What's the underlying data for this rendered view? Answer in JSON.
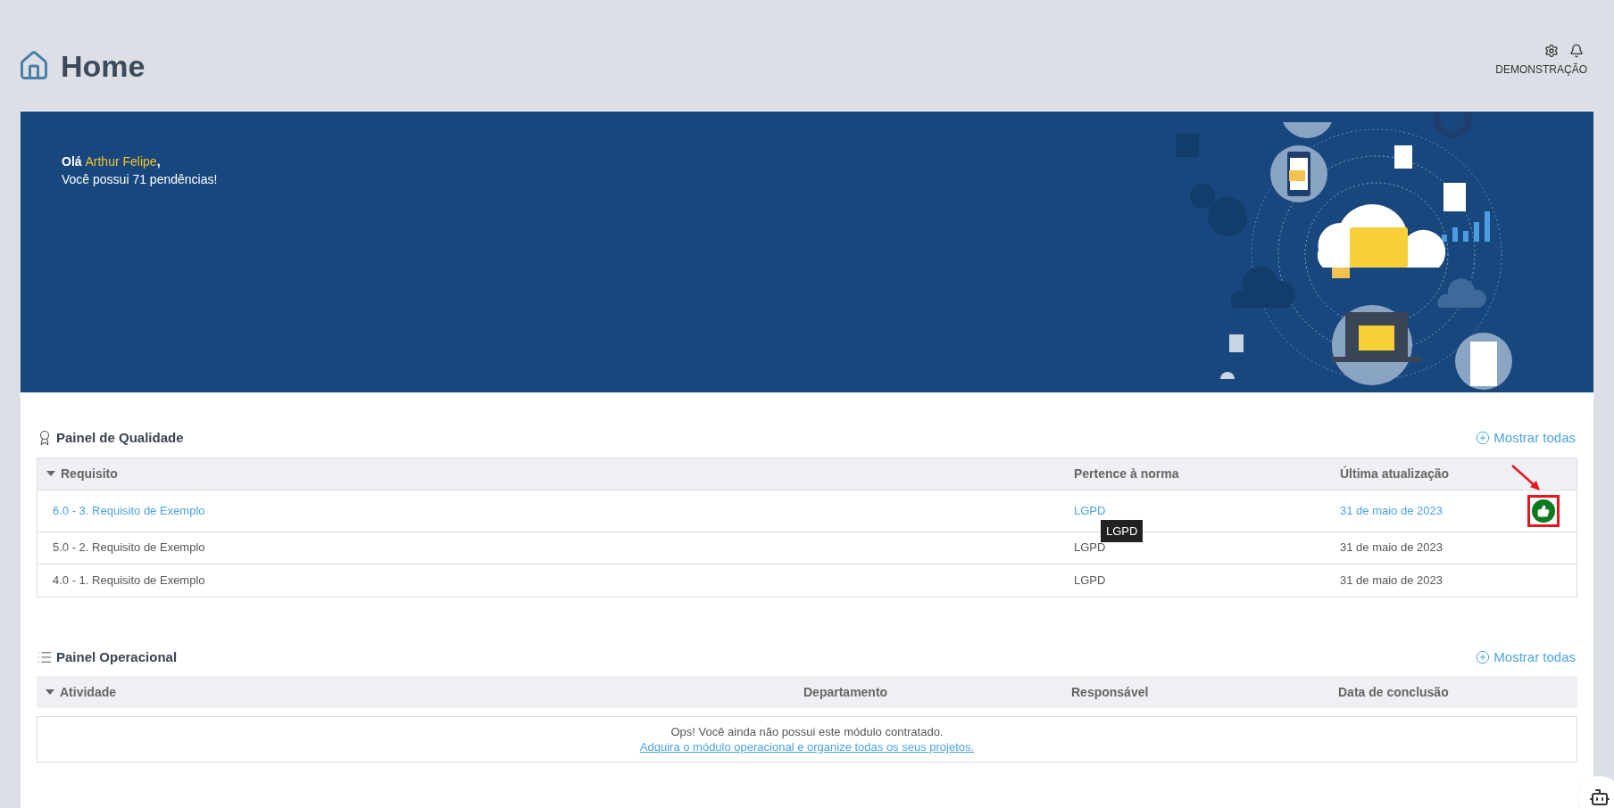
{
  "header": {
    "title": "Home",
    "user": "DEMONSTRAÇÃO"
  },
  "banner": {
    "greeting": "Olá",
    "name": "Arthur Felipe",
    "punctuation": ",",
    "message": "Você possui 71 pendências!"
  },
  "quality_panel": {
    "title": "Painel de Qualidade",
    "show_all": "Mostrar todas",
    "columns": [
      "Requisito",
      "Pertence à norma",
      "Última atualização"
    ],
    "rows": [
      {
        "requirement": "6.0 - 3. Requisito de Exemplo",
        "norm": "LGPD",
        "updated": "31 de maio de 2023",
        "highlighted": true,
        "tooltip": "LGPD"
      },
      {
        "requirement": "5.0 - 2. Requisito de Exemplo",
        "norm": "LGPD",
        "updated": "31 de maio de 2023",
        "highlighted": false
      },
      {
        "requirement": "4.0 - 1. Requisito de Exemplo",
        "norm": "LGPD",
        "updated": "31 de maio de 2023",
        "highlighted": false
      }
    ]
  },
  "operational_panel": {
    "title": "Painel Operacional",
    "show_all": "Mostrar todas",
    "columns": [
      "Atividade",
      "Departamento",
      "Responsável",
      "Data de conclusão"
    ],
    "empty_message": "Ops! Você ainda não possui este módulo contratado.",
    "empty_link": "Adquira o módulo operacional e organize todas os seus projetos."
  }
}
